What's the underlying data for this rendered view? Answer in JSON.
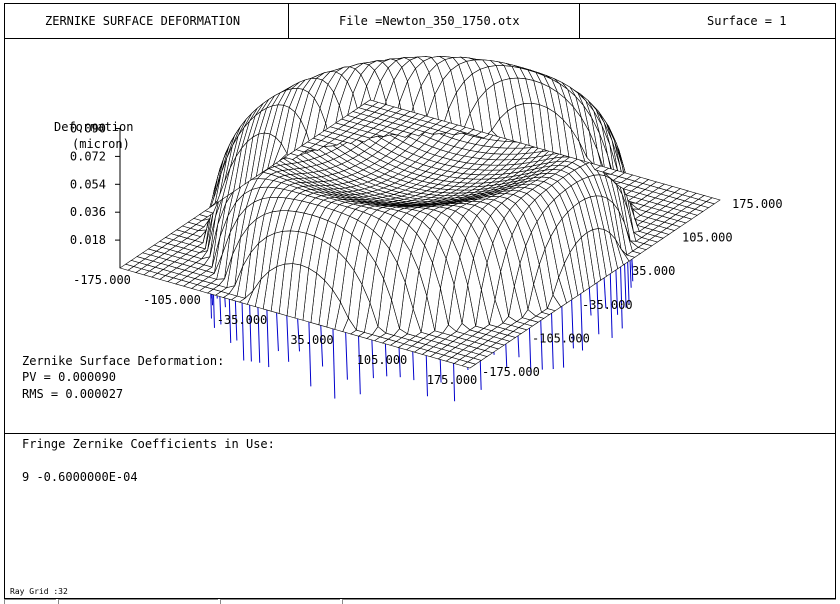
{
  "header": {
    "title": "ZERNIKE SURFACE DEFORMATION",
    "file": "File =Newton_350_1750.otx",
    "surface": "Surface = 1"
  },
  "axes": {
    "z_label_line1": "Deformation",
    "z_label_line2": "(micron)"
  },
  "chart_data": {
    "type": "surface",
    "title": "",
    "z_label": "Deformation (micron)",
    "z_ticks": [
      "0.090",
      "0.072",
      "0.054",
      "0.036",
      "0.018"
    ],
    "x_ticks": [
      "-175.000",
      "-105.000",
      "-35.000",
      "35.000",
      "105.000",
      "175.000"
    ],
    "y_ticks": [
      "175.000",
      "105.000",
      "35.000",
      "-35.000",
      "-105.000",
      "-175.000"
    ],
    "x_range": [
      -175,
      175
    ],
    "y_range": [
      -175,
      175
    ],
    "z_range": [
      0,
      0.09
    ],
    "grid_size": 32,
    "pv": 9e-05,
    "rms": 2.7e-05,
    "line_color": "#000000",
    "underside_color": "#0000cc"
  },
  "stats": {
    "heading": "Zernike Surface Deformation:",
    "pv": "PV  = 0.000090",
    "rms": "RMS = 0.000027"
  },
  "coefficients": {
    "heading": "Fringe Zernike Coefficients in Use:",
    "row": "9  -0.6000000E-04"
  },
  "footer": {
    "ray_grid": "Ray Grid :32"
  }
}
